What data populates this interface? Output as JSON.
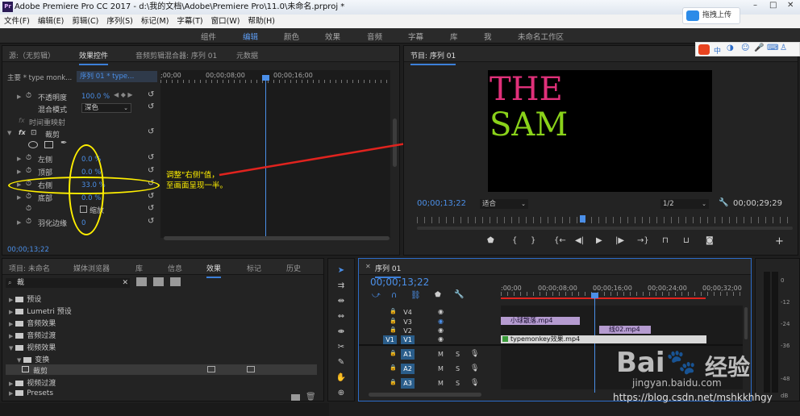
{
  "window": {
    "title": "Adobe Premiere Pro CC 2017 - d:\\我的文档\\Adobe\\Premiere Pro\\11.0\\未命名.prproj *",
    "upload_btn": "拖拽上传",
    "app_icon": "Pr"
  },
  "menu": [
    "文件(F)",
    "编辑(E)",
    "剪辑(C)",
    "序列(S)",
    "标记(M)",
    "字幕(T)",
    "窗口(W)",
    "帮助(H)"
  ],
  "workspaces": [
    "组件",
    "编辑",
    "颜色",
    "效果",
    "音频",
    "字幕",
    "库",
    "我",
    "未命名工作区"
  ],
  "effect_controls": {
    "tabs": [
      "源:（无剪辑）",
      "效果控件",
      "音频剪辑混合器: 序列 01",
      "元数据"
    ],
    "master": "主要 * type monk...",
    "seq": "序列 01 * type...",
    "timecodes": [
      ";00;00",
      "00;00;08;00",
      "00;00;16;00"
    ],
    "rows": {
      "opacity": "不透明度",
      "opacity_val": "100.0 %",
      "blend": "混合模式",
      "blend_val": "深色",
      "remap": "时间重映射",
      "fx": "fx",
      "crop": "裁剪",
      "left": "左侧",
      "left_val": "0.0 %",
      "top": "顶部",
      "top_val": "0.0 %",
      "right": "右侧",
      "right_val": "33.0 %",
      "bottom": "底部",
      "bottom_val": "0.0 %",
      "zoom": "缩放",
      "feather": "羽化边缘",
      "feather_val": "0"
    },
    "current_time": "00;00;13;22"
  },
  "annotation": "调整\"右侧\"值，\n至画面呈现一半。",
  "program": {
    "tab": "节目: 序列 01",
    "line1": "THE",
    "line2": "SAM",
    "timecode": "00;00;13;22",
    "fit": "适合",
    "quality": "1/2",
    "duration": "00;00;29;29"
  },
  "project": {
    "tabs": [
      "项目: 未命名",
      "媒体浏览器",
      "库",
      "信息",
      "效果",
      "标记",
      "历史"
    ],
    "search": "裁",
    "tree": [
      "预设",
      "Lumetri 预设",
      "音频效果",
      "音频过渡",
      "视频效果",
      "变换",
      "裁剪",
      "视频过渡",
      "Presets"
    ]
  },
  "timeline": {
    "tab": "序列 01",
    "timecode": "00;00;13;22",
    "ruler": [
      ":00;00",
      "00;00;08;00",
      "00;00;16;00",
      "00;00;24;00",
      "00;00;32;00"
    ],
    "tracks": [
      "V4",
      "V3",
      "V2",
      "V1",
      "A1",
      "A2",
      "A3"
    ],
    "clips": [
      {
        "name": "小球散落.mp4"
      },
      {
        "name": "线02.mp4"
      },
      {
        "name": "typemonkey效果.mp4"
      }
    ],
    "small_btns": [
      "M",
      "S"
    ]
  },
  "meter": [
    "0",
    "-12",
    "-24",
    "-36",
    "-48",
    "dB"
  ],
  "watermark": {
    "brand": "Bai",
    "brand2": "经验",
    "url": "jingyan.baidu.com",
    "blog": "https://blog.csdn.net/mshkkhhgy"
  },
  "ime": {
    "label": "中"
  },
  "colors": {
    "accent": "#4b8fe8",
    "annotation": "#ffef00",
    "arrow": "#e0231e",
    "text1": "#e0307a",
    "text2": "#8ad21a"
  }
}
